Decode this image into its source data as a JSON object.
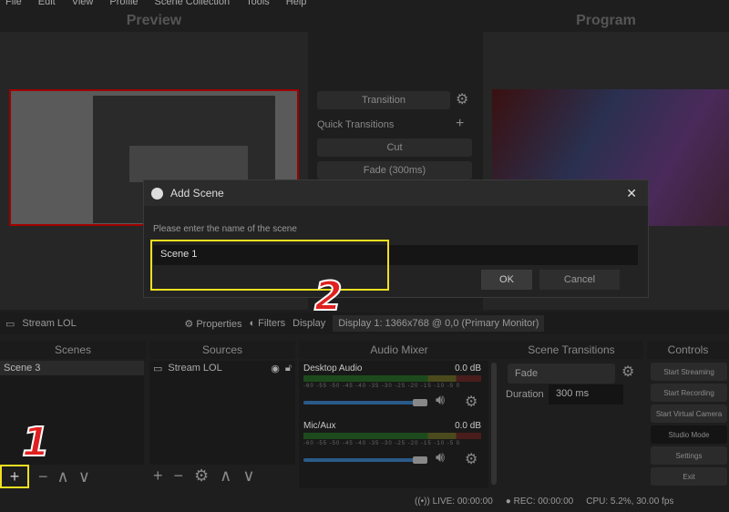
{
  "menu": [
    "File",
    "Edit",
    "View",
    "Profile",
    "Scene Collection",
    "Tools",
    "Help"
  ],
  "preview_title": "Preview",
  "program_title": "Program",
  "transition": {
    "button": "Transition",
    "quick": "Quick Transitions",
    "cut": "Cut",
    "fade": "Fade (300ms)"
  },
  "toolbar": {
    "source": "Stream LOL",
    "properties": "Properties",
    "filters": "Filters",
    "display": "Display",
    "display_value": "Display 1: 1366x768 @ 0,0 (Primary Monitor)"
  },
  "scenes": {
    "title": "Scenes",
    "items": [
      "Scene 3"
    ]
  },
  "sources": {
    "title": "Sources",
    "items": [
      "Stream LOL"
    ]
  },
  "audio": {
    "title": "Audio Mixer",
    "channels": [
      {
        "name": "Desktop Audio",
        "db": "0.0 dB"
      },
      {
        "name": "Mic/Aux",
        "db": "0.0 dB"
      }
    ],
    "scale": "-60 -55 -50 -45 -40 -35 -30 -25 -20 -15 -10 -5 0"
  },
  "scene_transitions": {
    "title": "Scene Transitions",
    "type": "Fade",
    "duration_label": "Duration",
    "duration": "300 ms"
  },
  "controls": {
    "title": "Controls",
    "buttons": [
      "Start Streaming",
      "Start Recording",
      "Start Virtual Camera",
      "Studio Mode",
      "Settings",
      "Exit"
    ]
  },
  "status": {
    "live": "LIVE: 00:00:00",
    "rec": "REC: 00:00:00",
    "cpu": "CPU: 5.2%, 30.00 fps"
  },
  "dialog": {
    "title": "Add Scene",
    "prompt": "Please enter the name of the scene",
    "value": "Scene 1",
    "ok": "OK",
    "cancel": "Cancel"
  },
  "annotations": {
    "step1": "1",
    "step2": "2"
  },
  "colors": {
    "highlight": "#f0e020",
    "annotation": "#e02020",
    "selection": "#c00000"
  }
}
